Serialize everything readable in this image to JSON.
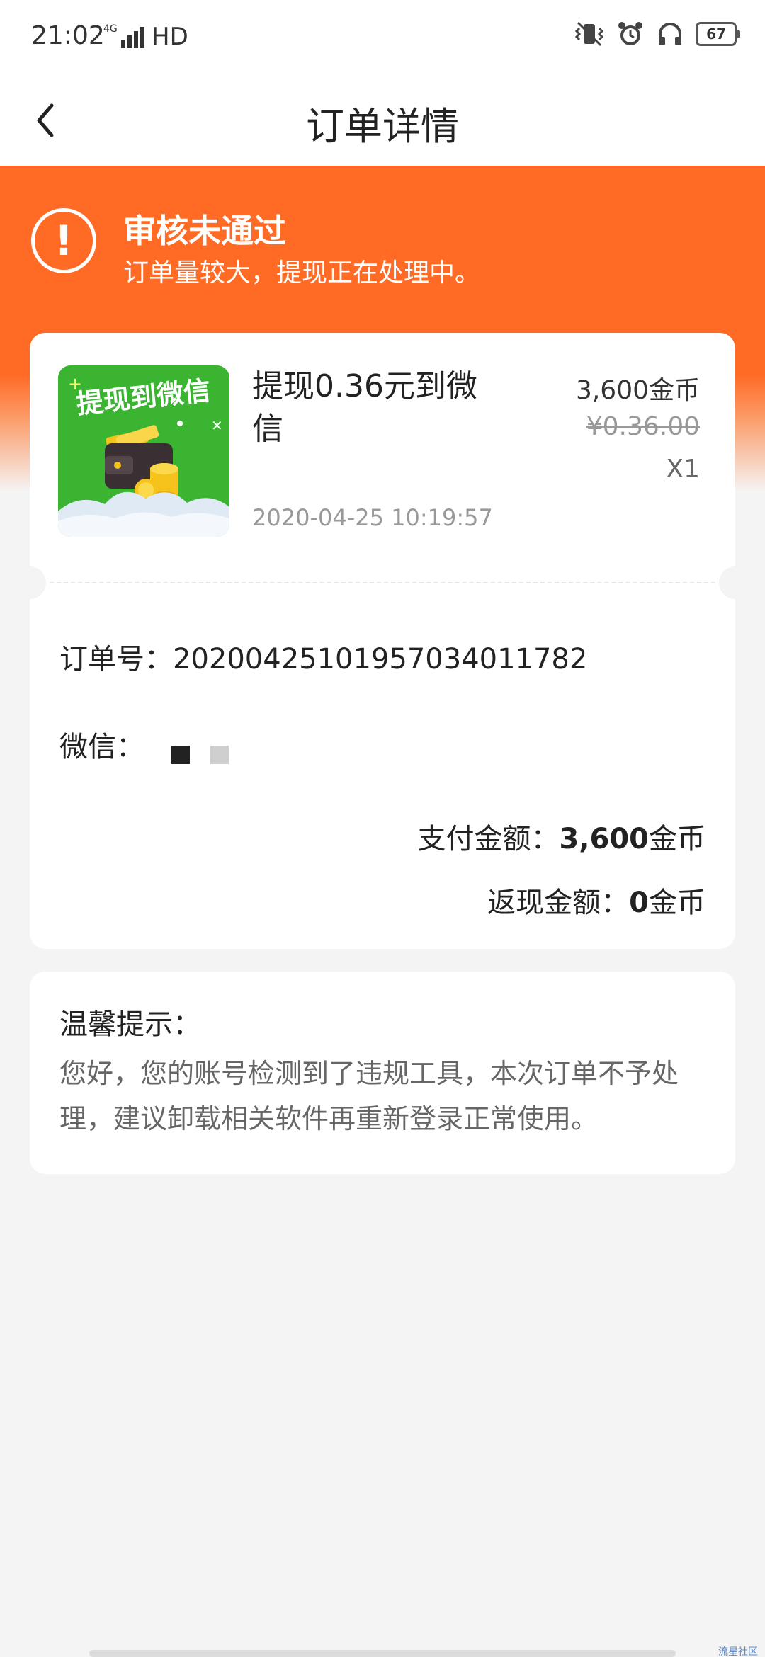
{
  "status_bar": {
    "time": "21:02",
    "network": "4G",
    "hd": "HD",
    "battery": "67"
  },
  "nav": {
    "title": "订单详情"
  },
  "banner": {
    "title": "审核未通过",
    "subtitle": "订单量较大，提现正在处理中。",
    "icon_glyph": "!"
  },
  "product": {
    "name": "提现0.36元到微信",
    "thumb_text": "提现到微信",
    "datetime": "2020-04-25  10:19:57",
    "coins": "3,600金币",
    "original_price": "¥0.36.00",
    "quantity": "X1"
  },
  "order": {
    "order_no_label": "订单号：",
    "order_no": "2020042510195703401178 2",
    "wechat_label": "微信：",
    "pay_label": "支付金额：",
    "pay_value": "3,600",
    "pay_unit": "金币",
    "refund_label": "返现金额：",
    "refund_value": "0",
    "refund_unit": "金币"
  },
  "tip": {
    "title": "温馨提示：",
    "body": "您好，您的账号检测到了违规工具，本次订单不予处理，建议卸载相关软件再重新登录正常使用。"
  },
  "watermark": "流星社区",
  "colors": {
    "accent": "#ff6a25",
    "background": "#f4f4f4",
    "thumb_green": "#3bb531"
  }
}
